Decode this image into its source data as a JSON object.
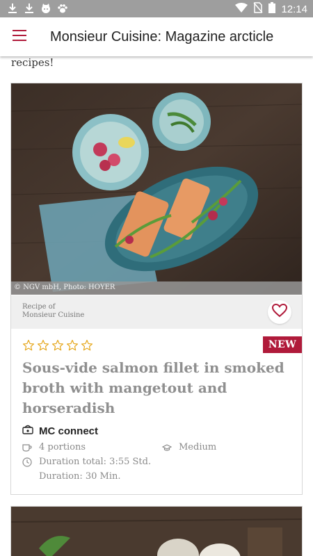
{
  "status_bar": {
    "time": "12:14",
    "left_icons": [
      "download-icon",
      "download-icon",
      "cat-icon",
      "paw-icon"
    ],
    "right_icons": [
      "wifi-icon",
      "no-sim-icon",
      "battery-icon"
    ]
  },
  "app_bar": {
    "title": "Monsieur Cuisine: Magazine arcticle",
    "menu_icon": "hamburger-menu-icon"
  },
  "article": {
    "intro_text_fragment": "recipes!"
  },
  "recipe_card": {
    "photo_credit": "© NGV mbH, Photo: HOYER",
    "source_line1": "Recipe of",
    "source_line2": "Monsieur Cuisine",
    "favorite_icon": "heart-outline-icon",
    "rating": {
      "filled": 0,
      "total": 5
    },
    "badge": "NEW",
    "title": "Sous-vide salmon fillet in smoked broth with mangetout and horseradish",
    "mc_connect_label": "MC connect",
    "portions": "4 portions",
    "difficulty": "Medium",
    "duration_total": "Duration total: 3:55 Std.",
    "duration": "Duration: 30 Min."
  },
  "colors": {
    "accent": "#b01a3a",
    "star": "#e6a81e",
    "title_gray": "#8f8f8f",
    "status_bar": "#9e9e9e"
  }
}
